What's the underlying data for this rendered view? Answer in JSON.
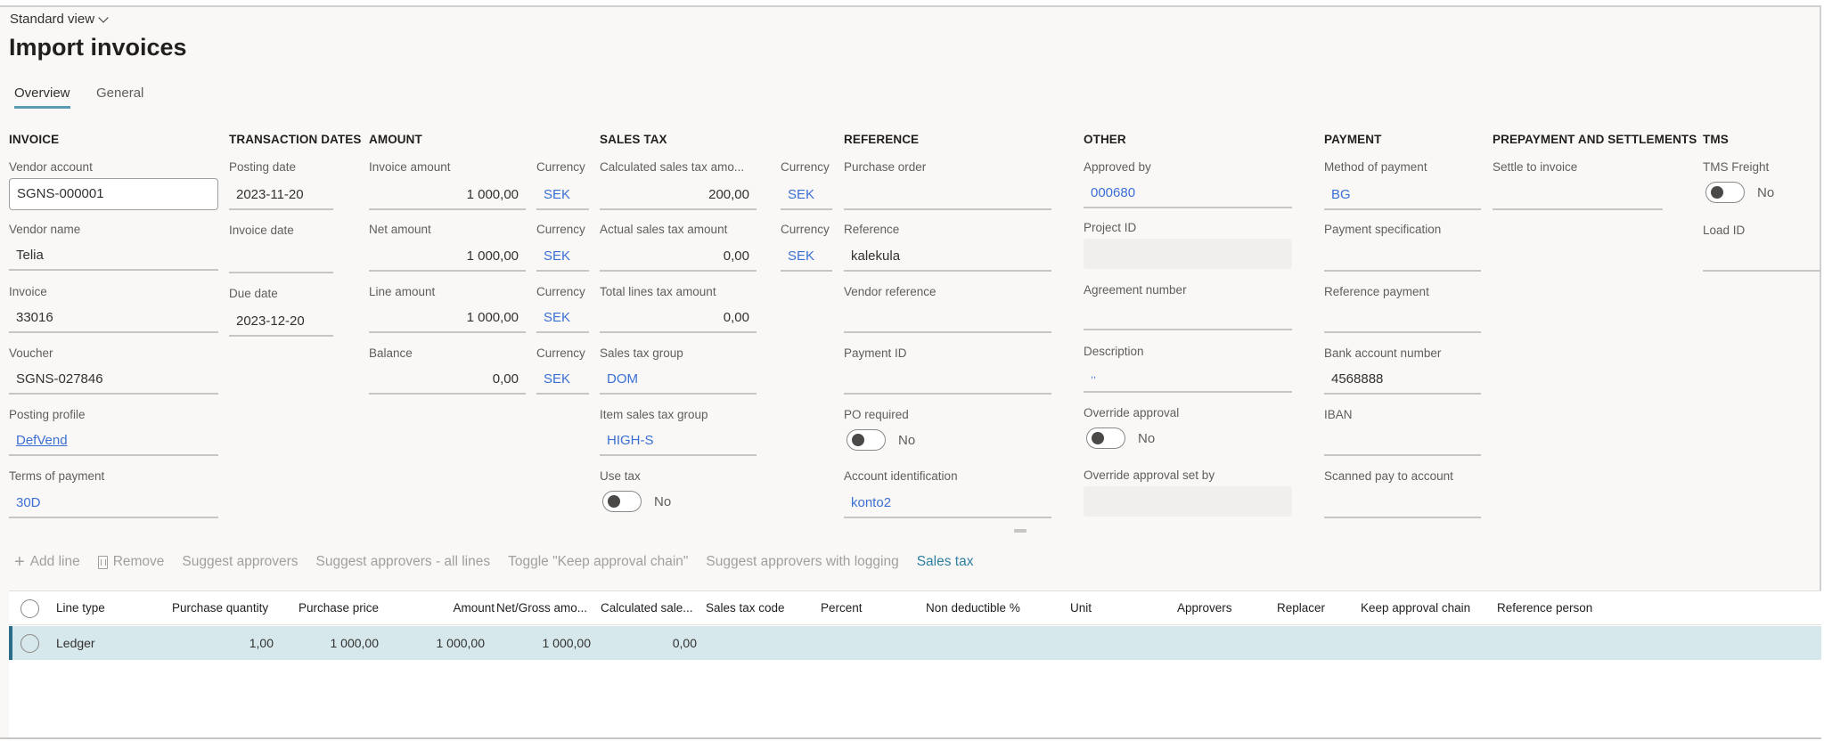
{
  "header": {
    "view_selector": "Standard view",
    "title": "Import invoices"
  },
  "tabs": [
    {
      "label": "Overview",
      "active": true
    },
    {
      "label": "General",
      "active": false
    }
  ],
  "sections": {
    "invoice": {
      "heading": "INVOICE",
      "vendor_account": {
        "label": "Vendor account",
        "value": "SGNS-000001"
      },
      "vendor_name": {
        "label": "Vendor name",
        "value": "Telia"
      },
      "invoice": {
        "label": "Invoice",
        "value": "33016"
      },
      "voucher": {
        "label": "Voucher",
        "value": "SGNS-027846"
      },
      "posting_profile": {
        "label": "Posting profile",
        "value": "DefVend"
      },
      "terms_of_payment": {
        "label": "Terms of payment",
        "value": "30D"
      }
    },
    "transaction_dates": {
      "heading": "TRANSACTION DATES",
      "posting_date": {
        "label": "Posting date",
        "value": "2023-11-20"
      },
      "invoice_date": {
        "label": "Invoice date",
        "value": ""
      },
      "due_date": {
        "label": "Due date",
        "value": "2023-12-20"
      }
    },
    "amount": {
      "heading": "AMOUNT",
      "invoice_amount": {
        "label": "Invoice amount",
        "value": "1 000,00",
        "currency_label": "Currency",
        "currency": "SEK"
      },
      "net_amount": {
        "label": "Net amount",
        "value": "1 000,00",
        "currency_label": "Currency",
        "currency": "SEK"
      },
      "line_amount": {
        "label": "Line amount",
        "value": "1 000,00",
        "currency_label": "Currency",
        "currency": "SEK"
      },
      "balance": {
        "label": "Balance",
        "value": "0,00",
        "currency_label": "Currency",
        "currency": "SEK"
      }
    },
    "sales_tax": {
      "heading": "SALES TAX",
      "calculated": {
        "label": "Calculated sales tax amo...",
        "value": "200,00",
        "currency_label": "Currency",
        "currency": "SEK"
      },
      "actual": {
        "label": "Actual sales tax amount",
        "value": "0,00",
        "currency_label": "Currency",
        "currency": "SEK"
      },
      "total_lines": {
        "label": "Total lines tax amount",
        "value": "0,00"
      },
      "sales_tax_group": {
        "label": "Sales tax group",
        "value": "DOM"
      },
      "item_sales_tax_group": {
        "label": "Item sales tax group",
        "value": "HIGH-S"
      },
      "use_tax": {
        "label": "Use tax",
        "value": "No",
        "on": false
      }
    },
    "reference": {
      "heading": "REFERENCE",
      "purchase_order": {
        "label": "Purchase order",
        "value": ""
      },
      "reference": {
        "label": "Reference",
        "value": "kalekula"
      },
      "vendor_reference": {
        "label": "Vendor reference",
        "value": ""
      },
      "payment_id": {
        "label": "Payment ID",
        "value": ""
      },
      "po_required": {
        "label": "PO required",
        "value": "No",
        "on": false
      },
      "account_identification": {
        "label": "Account identification",
        "value": "konto2"
      }
    },
    "other": {
      "heading": "OTHER",
      "approved_by": {
        "label": "Approved by",
        "value": "000680"
      },
      "project_id": {
        "label": "Project ID",
        "value": ""
      },
      "agreement_number": {
        "label": "Agreement number",
        "value": ""
      },
      "description": {
        "label": "Description",
        "value": ",,"
      },
      "override_approval": {
        "label": "Override approval",
        "value": "No",
        "on": false
      },
      "override_approval_set_by": {
        "label": "Override approval set by",
        "value": ""
      }
    },
    "payment": {
      "heading": "PAYMENT",
      "method_of_payment": {
        "label": "Method of payment",
        "value": "BG"
      },
      "payment_specification": {
        "label": "Payment specification",
        "value": ""
      },
      "reference_payment": {
        "label": "Reference payment",
        "value": ""
      },
      "bank_account_number": {
        "label": "Bank account number",
        "value": "4568888"
      },
      "iban": {
        "label": "IBAN",
        "value": ""
      },
      "scanned_pay_to_account": {
        "label": "Scanned pay to account",
        "value": ""
      }
    },
    "prepayment": {
      "heading": "PREPAYMENT AND SETTLEMENTS",
      "settle_to_invoice": {
        "label": "Settle to invoice",
        "value": ""
      }
    },
    "tms": {
      "heading": "TMS",
      "tms_freight": {
        "label": "TMS Freight",
        "value": "No",
        "on": false
      },
      "load_id": {
        "label": "Load ID",
        "value": ""
      }
    }
  },
  "toolbar": {
    "add_line": "Add line",
    "remove": "Remove",
    "suggest_approvers": "Suggest approvers",
    "suggest_approvers_all": "Suggest approvers - all lines",
    "toggle_keep_chain": "Toggle \"Keep approval chain\"",
    "suggest_with_logging": "Suggest approvers with logging",
    "sales_tax": "Sales tax"
  },
  "grid": {
    "columns": [
      "Line type",
      "Purchase quantity",
      "Purchase price",
      "Amount",
      "Net/Gross amo...",
      "Calculated sale...",
      "Sales tax code",
      "Percent",
      "Non deductible %",
      "Unit",
      "Approvers",
      "Replacer",
      "Keep approval chain",
      "Reference person"
    ],
    "rows": [
      {
        "line_type": "Ledger",
        "purchase_quantity": "1,00",
        "purchase_price": "1 000,00",
        "amount": "1 000,00",
        "net_gross_amount": "1 000,00",
        "calculated_sales_tax": "0,00",
        "selected": true
      }
    ]
  },
  "colors": {
    "accent": "#2a6d8a",
    "link": "#3b6fd4",
    "selected_row": "#d6e8ec",
    "background": "#f9f8f7"
  }
}
